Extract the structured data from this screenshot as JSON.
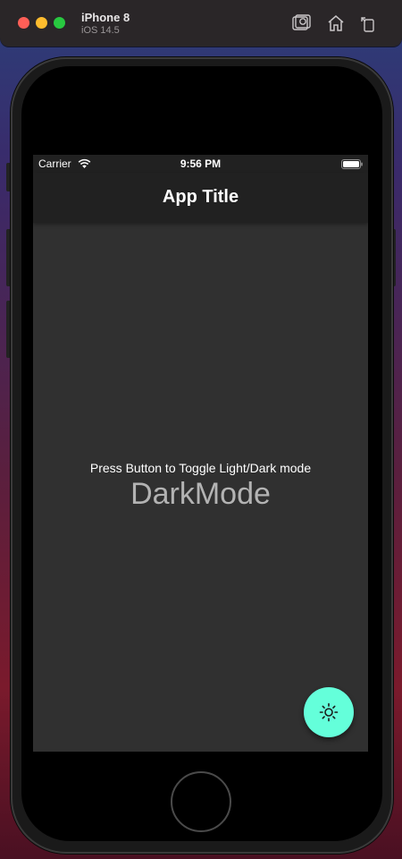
{
  "window": {
    "device_name": "iPhone 8",
    "os_version": "iOS 14.5",
    "toolbar_icons": [
      "screenshot-icon",
      "home-icon",
      "rotate-icon"
    ]
  },
  "status_bar": {
    "carrier": "Carrier",
    "time": "9:56 PM"
  },
  "app": {
    "title": "App Title",
    "instruction": "Press Button to Toggle Light/Dark mode",
    "mode_label": "DarkMode",
    "fab_icon": "sun-icon",
    "colors": {
      "app_bar": "#212121",
      "background": "#303030",
      "fab": "#64ffda",
      "mode_text": "#b3b3b3"
    }
  }
}
